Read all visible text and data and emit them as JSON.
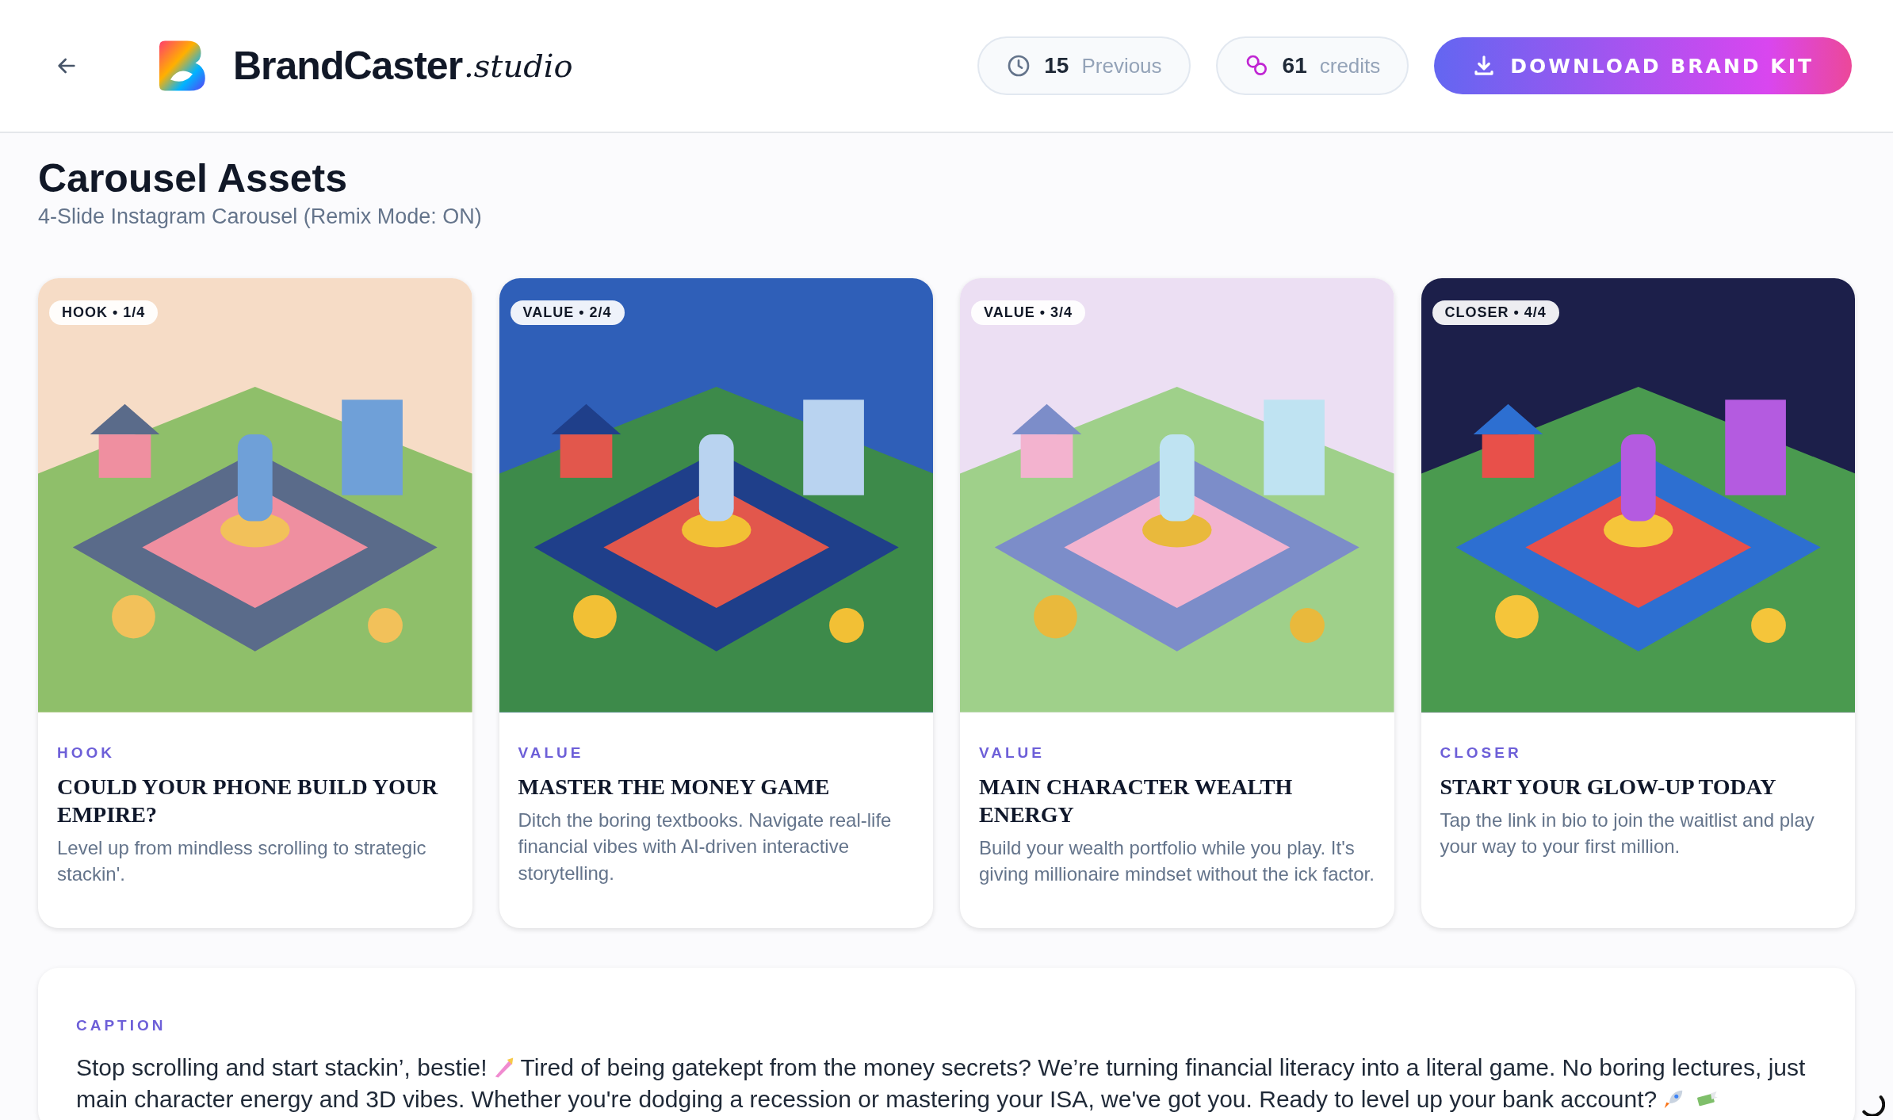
{
  "header": {
    "brand_name": "BrandCaster",
    "brand_suffix": ".studio",
    "history": {
      "count": "15",
      "label": "Previous"
    },
    "credits": {
      "count": "61",
      "label": "credits"
    },
    "download_button": "DOWNLOAD BRAND KIT"
  },
  "page": {
    "title": "Carousel Assets",
    "subtitle": "4-Slide Instagram Carousel (Remix Mode: ON)"
  },
  "slides": [
    {
      "badge": "HOOK • 1/4",
      "label": "HOOK",
      "title": "COULD YOUR PHONE BUILD YOUR EMPIRE?",
      "description": "Level up from mindless scrolling to strategic stackin'."
    },
    {
      "badge": "VALUE • 2/4",
      "label": "VALUE",
      "title": "MASTER THE MONEY GAME",
      "description": "Ditch the boring textbooks. Navigate real-life financial vibes with AI-driven interactive storytelling."
    },
    {
      "badge": "VALUE • 3/4",
      "label": "VALUE",
      "title": "MAIN CHARACTER WEALTH ENERGY",
      "description": "Build your wealth portfolio while you play. It's giving millionaire mindset without the ick factor."
    },
    {
      "badge": "CLOSER • 4/4",
      "label": "CLOSER",
      "title": "START YOUR GLOW-UP TODAY",
      "description": "Tap the link in bio to join the waitlist and play your way to your first million."
    }
  ],
  "caption": {
    "label": "CAPTION",
    "lines": [
      [
        {
          "kind": "text",
          "text": "Stop scrolling and start stackin’, bestie!"
        },
        {
          "kind": "icon"
        },
        {
          "kind": "text",
          "text": "Tired of being gatekept from the money secrets? We’re turning financial literacy into a literal game. No boring lectures, just"
        }
      ],
      [
        {
          "kind": "text",
          "text": "main character energy and 3D vibes. Whether you're dodging a recession or mastering your ISA, we've got you. Ready to level up your bank account?"
        },
        {
          "kind": "icon"
        },
        {
          "kind": "icon"
        }
      ]
    ]
  }
}
